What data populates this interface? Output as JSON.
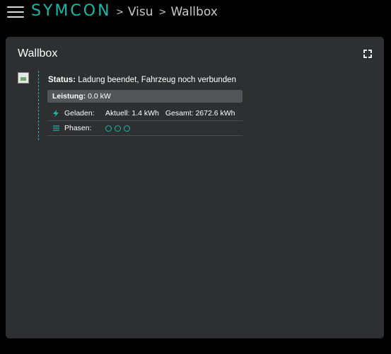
{
  "header": {
    "logo_text": "SYMCON",
    "breadcrumbs": [
      "Visu",
      "Wallbox"
    ],
    "accent_color": "#19b8a6"
  },
  "card": {
    "title": "Wallbox",
    "status_label": "Status:",
    "status_value": "Ladung beendet, Fahrzeug noch verbunden",
    "power_label": "Leistung:",
    "power_value": "0.0 kW",
    "charged": {
      "icon": "lightning-icon",
      "label": "Geladen:",
      "current": "Aktuell: 1.4 kWh",
      "total": "Gesamt: 2672.6 kWh"
    },
    "phases": {
      "icon": "list-icon",
      "label": "Phasen:",
      "count": 3
    }
  }
}
